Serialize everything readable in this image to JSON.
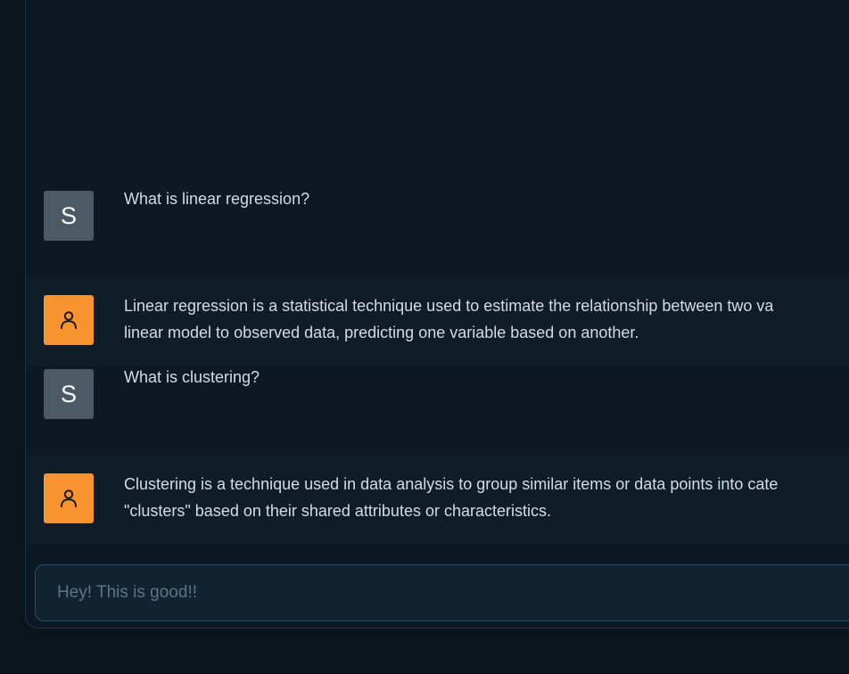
{
  "chat": {
    "messages": [
      {
        "role": "user",
        "avatar": "S",
        "text": "What is linear regression?"
      },
      {
        "role": "assistant",
        "avatar_icon": "person-icon",
        "lines": [
          "Linear regression is a statistical technique used to estimate the relationship between two va",
          "linear model to observed data, predicting one variable based on another."
        ]
      },
      {
        "role": "user",
        "avatar": "S",
        "text": "What is clustering?"
      },
      {
        "role": "assistant",
        "avatar_icon": "person-icon",
        "lines": [
          "Clustering is a technique used in data analysis to group similar items or data points into cate",
          "\"clusters\" based on their shared attributes or characteristics."
        ]
      }
    ]
  },
  "composer": {
    "value": "Hey! This is good!!"
  },
  "colors": {
    "background": "#0b131b",
    "panel": "#0c1823",
    "assistant_row": "#0f1d29",
    "user_avatar": "#4b5a64",
    "assistant_avatar": "#f79430",
    "input_border": "#27506a"
  }
}
